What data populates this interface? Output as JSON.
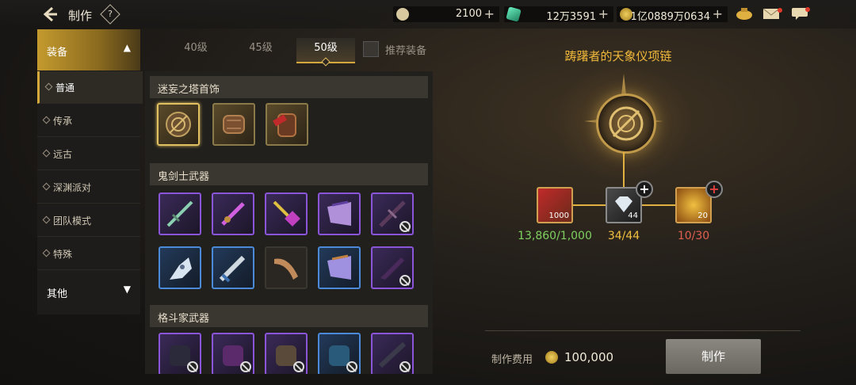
{
  "header": {
    "title": "制作",
    "help_label": "?"
  },
  "currencies": [
    {
      "icon": "c-coin-icon",
      "value": "2100"
    },
    {
      "icon": "green-crystal-icon",
      "value": "12万3591"
    },
    {
      "icon": "gold-coin-icon",
      "value": "1亿0889万0634"
    }
  ],
  "sidebar": {
    "categories": [
      {
        "label": "装备",
        "expanded": true
      },
      {
        "label": "其他",
        "expanded": false
      }
    ],
    "items": [
      {
        "label": "普通",
        "selected": true
      },
      {
        "label": "传承"
      },
      {
        "label": "远古"
      },
      {
        "label": "深渊派对"
      },
      {
        "label": "团队模式"
      },
      {
        "label": "特殊"
      }
    ]
  },
  "tabs": [
    {
      "label": "40级"
    },
    {
      "label": "45级"
    },
    {
      "label": "50级",
      "selected": true
    }
  ],
  "recommend": {
    "label": "推荐装备",
    "checked": false
  },
  "sections": [
    {
      "title": "迷妄之塔首饰"
    },
    {
      "title": "鬼剑士武器"
    },
    {
      "title": "格斗家武器"
    }
  ],
  "detail": {
    "item_name": "踌躇者的天象仪项链",
    "materials": [
      {
        "qty": "1000",
        "count": "13,860/1,000",
        "color": "#7fd060"
      },
      {
        "qty": "44",
        "count": "34/44",
        "color": "#f0c040"
      },
      {
        "qty": "20",
        "count": "10/30",
        "color": "#e06050"
      }
    ],
    "cost_label": "制作费用",
    "cost_value": "100,000",
    "make_label": "制作"
  }
}
